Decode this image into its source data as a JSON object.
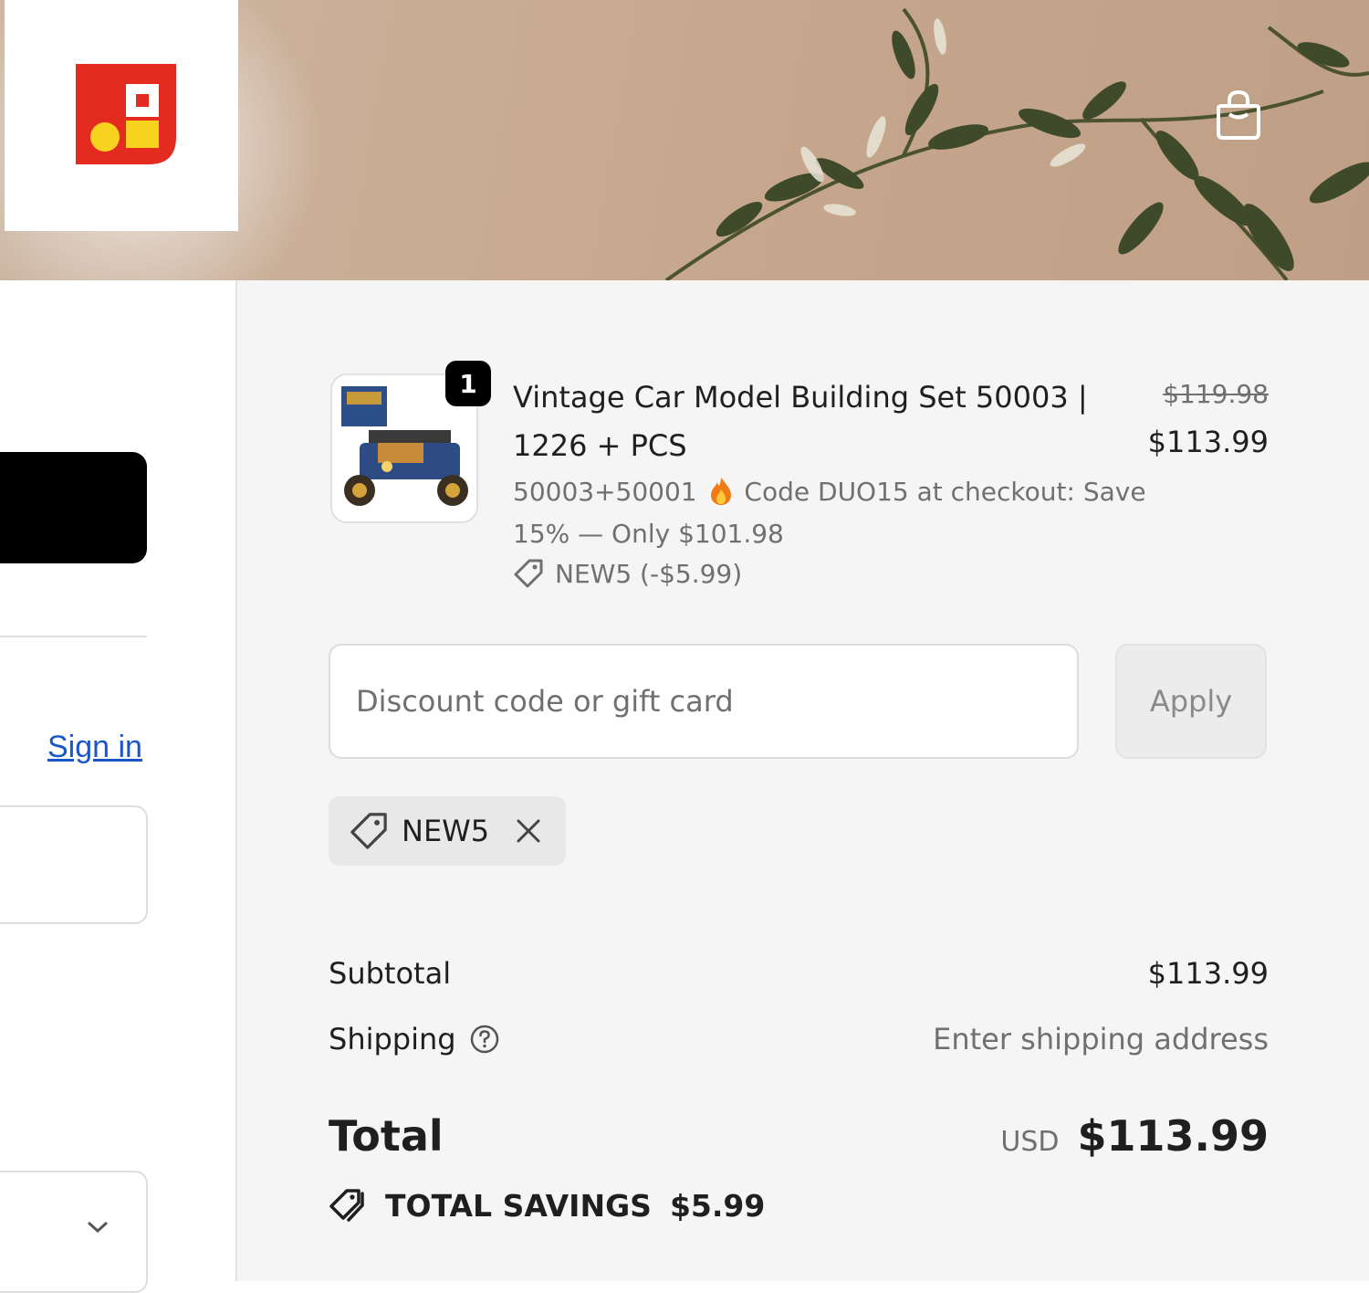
{
  "header": {
    "logo_icon": "brand-logo",
    "cart_icon": "shopping-bag-icon"
  },
  "left": {
    "sign_in_label": "Sign in",
    "select_icon": "chevron-down-icon"
  },
  "summary": {
    "line_item": {
      "quantity": "1",
      "title": "Vintage Car Model Building Set 50003 | 1226 + PCS",
      "variant_prefix": "50003+50001",
      "variant_icon": "fire-emoji",
      "variant_promo": "Code DUO15 at checkout: Save 15% — Only $101.98",
      "discount_icon": "tag-icon",
      "discount_text": "NEW5 (-$5.99)",
      "original_price": "$119.98",
      "price": "$113.99"
    },
    "discount_field": {
      "placeholder": "Discount code or gift card",
      "apply_label": "Apply"
    },
    "applied_code": {
      "code": "NEW5",
      "icon": "tag-icon",
      "remove_icon": "close-icon"
    },
    "subtotal": {
      "label": "Subtotal",
      "value": "$113.99"
    },
    "shipping": {
      "label": "Shipping",
      "help_icon": "question-circle-icon",
      "value": "Enter shipping address"
    },
    "total": {
      "label": "Total",
      "currency": "USD",
      "value": "$113.99"
    },
    "savings": {
      "icon": "tags-icon",
      "label": "TOTAL SAVINGS",
      "value": "$5.99"
    }
  }
}
